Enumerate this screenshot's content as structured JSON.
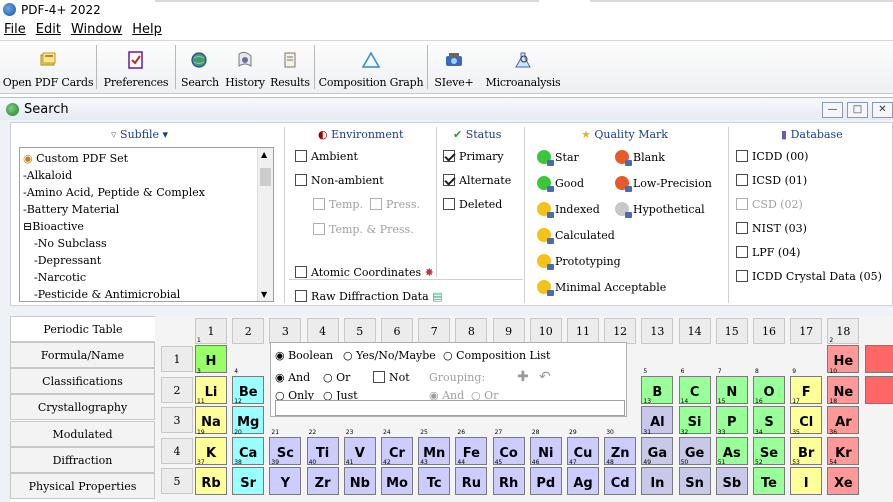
{
  "window": {
    "title": "PDF-4+ 2022"
  },
  "menu": {
    "file": "File",
    "edit": "Edit",
    "window": "Window",
    "help": "Help"
  },
  "toolbar": {
    "open_pdf_cards": "Open PDF Cards",
    "preferences": "Preferences",
    "search": "Search",
    "history": "History",
    "results": "Results",
    "composition_graph": "Composition Graph",
    "sieve": "SIeve+",
    "microanalysis": "Microanalysis"
  },
  "search_window": {
    "title": "Search"
  },
  "subfile": {
    "header": "Subfile",
    "items": [
      "Custom PDF Set",
      "Alkaloid",
      "Amino Acid, Peptide & Complex",
      "Battery Material",
      "Bioactive",
      "No Subclass",
      "Depressant",
      "Narcotic",
      "Pesticide & Antimicrobial"
    ]
  },
  "environment": {
    "header": "Environment",
    "ambient": "Ambient",
    "non_ambient": "Non-ambient",
    "temp": "Temp.",
    "press": "Press.",
    "temp_press": "Temp. & Press.",
    "atomic_coordinates": "Atomic Coordinates",
    "raw_diffraction": "Raw Diffraction Data"
  },
  "status": {
    "header": "Status",
    "primary": "Primary",
    "alternate": "Alternate",
    "deleted": "Deleted"
  },
  "quality": {
    "header": "Quality Mark",
    "star": "Star",
    "blank": "Blank",
    "good": "Good",
    "low_precision": "Low-Precision",
    "indexed": "Indexed",
    "hypothetical": "Hypothetical",
    "calculated": "Calculated",
    "prototyping": "Prototyping",
    "minimal": "Minimal Acceptable"
  },
  "database": {
    "header": "Database",
    "icdd": "ICDD (00)",
    "icsd": "ICSD (01)",
    "csd": "CSD (02)",
    "nist": "NIST (03)",
    "lpf": "LPF (04)",
    "crystal": "ICDD Crystal Data (05)"
  },
  "tabs": [
    "Periodic Table",
    "Formula/Name",
    "Classifications",
    "Crystallography",
    "Modulated",
    "Diffraction",
    "Physical Properties"
  ],
  "periodic": {
    "groups": [
      "1",
      "2",
      "3",
      "4",
      "5",
      "6",
      "7",
      "8",
      "9",
      "10",
      "11",
      "12",
      "13",
      "14",
      "15",
      "16",
      "17",
      "18"
    ],
    "periods": [
      "1",
      "2",
      "3",
      "4",
      "5"
    ],
    "options": {
      "boolean": "Boolean",
      "yes_no_maybe": "Yes/No/Maybe",
      "composition_list": "Composition List",
      "and": "And",
      "or": "Or",
      "not": "Not",
      "grouping": "Grouping:",
      "g_and": "And",
      "g_or": "Or",
      "only": "Only",
      "just": "Just"
    }
  },
  "colors": {
    "alkali": "#ffff99",
    "alkaline": "#99ffff",
    "transition": "#ccccff",
    "post_trans": "#c8c8e8",
    "nonmetal": "#99ff99",
    "halogen": "#ffff99",
    "noble": "#ff9999",
    "hydrogen": "#99ff66"
  }
}
